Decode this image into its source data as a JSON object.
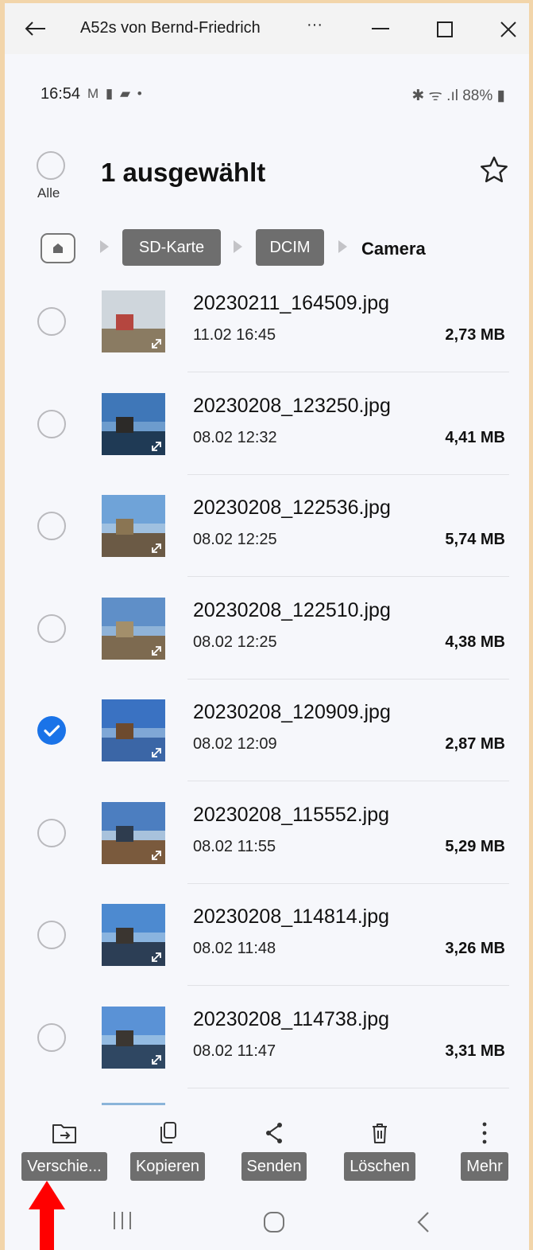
{
  "window": {
    "title": "A52s von Bernd-Friedrich",
    "more": "···"
  },
  "status_bar": {
    "time": "16:54",
    "notif_icons": "M ▮ ▰ •",
    "right": "✱ ᯤ .ıl 88% ▮"
  },
  "header": {
    "select_all_label": "Alle",
    "title": "1 ausgewählt"
  },
  "breadcrumb": {
    "items": [
      "SD-Karte",
      "DCIM"
    ],
    "current": "Camera"
  },
  "files": [
    {
      "name": "20230211_164509.jpg",
      "date": "11.02 16:45",
      "size": "2,73 MB",
      "selected": false
    },
    {
      "name": "20230208_123250.jpg",
      "date": "08.02 12:32",
      "size": "4,41 MB",
      "selected": false
    },
    {
      "name": "20230208_122536.jpg",
      "date": "08.02 12:25",
      "size": "5,74 MB",
      "selected": false
    },
    {
      "name": "20230208_122510.jpg",
      "date": "08.02 12:25",
      "size": "4,38 MB",
      "selected": false
    },
    {
      "name": "20230208_120909.jpg",
      "date": "08.02 12:09",
      "size": "2,87 MB",
      "selected": true
    },
    {
      "name": "20230208_115552.jpg",
      "date": "08.02 11:55",
      "size": "5,29 MB",
      "selected": false
    },
    {
      "name": "20230208_114814.jpg",
      "date": "08.02 11:48",
      "size": "3,26 MB",
      "selected": false
    },
    {
      "name": "20230208_114738.jpg",
      "date": "08.02 11:47",
      "size": "3,31 MB",
      "selected": false
    }
  ],
  "actions": {
    "move": "Verschie...",
    "copy": "Kopieren",
    "send": "Senden",
    "delete": "Löschen",
    "more": "Mehr"
  },
  "colors": {
    "accent": "#1a73e8",
    "label_bg": "#6e6e6e",
    "annotation_arrow": "#ff0000"
  }
}
